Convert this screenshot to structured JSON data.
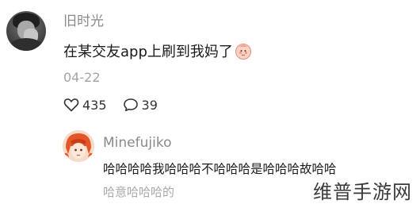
{
  "post": {
    "username": "旧时光",
    "content": "在某交友app上刷到我妈了",
    "emoji": "baby-face-emoji",
    "date": "04-22",
    "likes": "435",
    "comments": "39"
  },
  "reply": {
    "username": "Minefujiko",
    "text": "哈哈哈哈我哈哈哈不哈哈哈是哈哈哈故哈哈",
    "text_overflow": "哈意哈哈哈的"
  },
  "watermark": "维普手游网",
  "colors": {
    "username": "#8a8a8a",
    "date": "#a3a3a3",
    "text": "#1a1a1a"
  }
}
